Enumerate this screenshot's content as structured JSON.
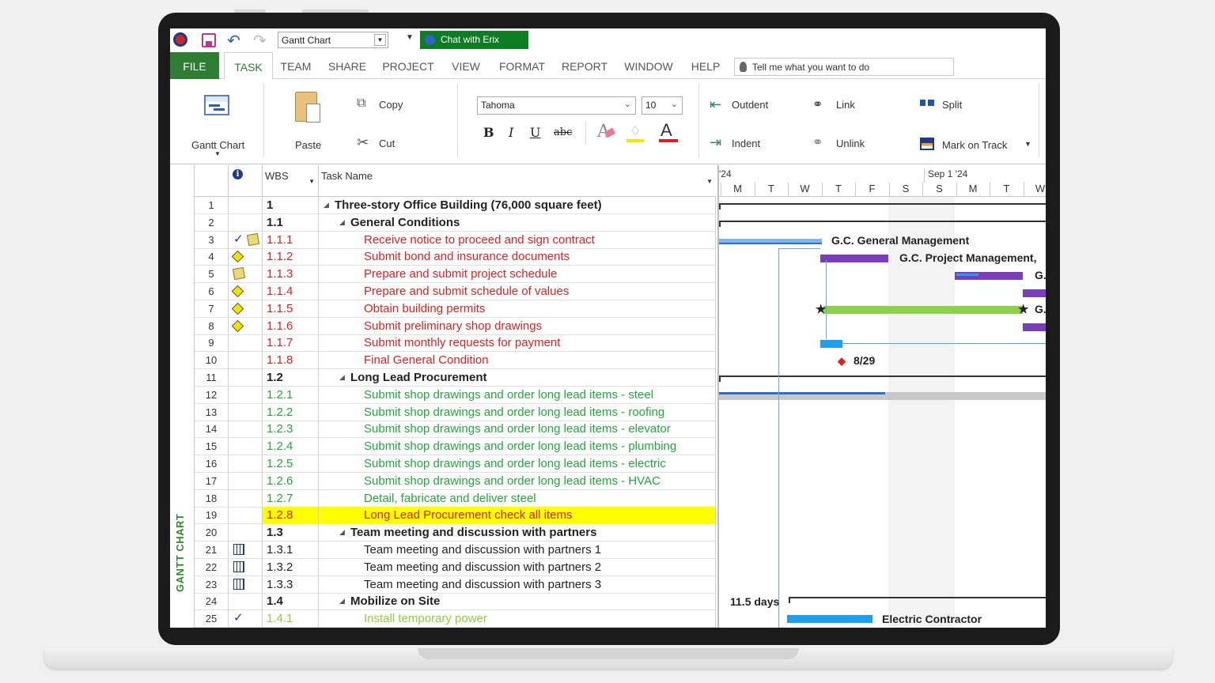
{
  "quick_access": {
    "view_selector": "Gantt Chart",
    "chat_label": "Chat with Erix"
  },
  "tabs": [
    "FILE",
    "TASK",
    "TEAM",
    "SHARE",
    "PROJECT",
    "VIEW",
    "FORMAT",
    "REPORT",
    "WINDOW",
    "HELP"
  ],
  "tell_me_placeholder": "Tell me what you want to do",
  "ribbon": {
    "gantt_chart": "Gantt Chart",
    "paste": "Paste",
    "copy": "Copy",
    "cut": "Cut",
    "font_name": "Tahoma",
    "font_size": "10",
    "bold": "B",
    "italic": "I",
    "underline": "U",
    "strike": "abc",
    "outdent": "Outdent",
    "indent": "Indent",
    "link": "Link",
    "unlink": "Unlink",
    "split": "Split",
    "mark_on_track": "Mark on Track"
  },
  "side_label": "GANTT CHART",
  "grid": {
    "col_wbs": "WBS",
    "col_task": "Task Name",
    "rows": [
      {
        "id": "1",
        "wbs": "1",
        "name": "Three-story Office Building (76,000 square feet)",
        "level": 0,
        "summary": true,
        "color": "#222222",
        "indicators": []
      },
      {
        "id": "2",
        "wbs": "1.1",
        "name": "General Conditions",
        "level": 1,
        "summary": true,
        "color": "#222222",
        "indicators": []
      },
      {
        "id": "3",
        "wbs": "1.1.1",
        "name": "Receive notice to proceed and sign contract",
        "level": 2,
        "summary": false,
        "color": "#e02020",
        "indicators": [
          "check",
          "note"
        ]
      },
      {
        "id": "4",
        "wbs": "1.1.2",
        "name": "Submit bond and insurance documents",
        "level": 2,
        "summary": false,
        "color": "#e02020",
        "indicators": [
          "warn"
        ]
      },
      {
        "id": "5",
        "wbs": "1.1.3",
        "name": "Prepare and submit project schedule",
        "level": 2,
        "summary": false,
        "color": "#e02020",
        "indicators": [
          "note"
        ]
      },
      {
        "id": "6",
        "wbs": "1.1.4",
        "name": "Prepare and submit schedule of values",
        "level": 2,
        "summary": false,
        "color": "#e02020",
        "indicators": [
          "warn"
        ]
      },
      {
        "id": "7",
        "wbs": "1.1.5",
        "name": "Obtain building permits",
        "level": 2,
        "summary": false,
        "color": "#e02020",
        "indicators": [
          "warn"
        ]
      },
      {
        "id": "8",
        "wbs": "1.1.6",
        "name": "Submit preliminary shop drawings",
        "level": 2,
        "summary": false,
        "color": "#e02020",
        "indicators": [
          "warn"
        ]
      },
      {
        "id": "9",
        "wbs": "1.1.7",
        "name": "Submit monthly requests for payment",
        "level": 2,
        "summary": false,
        "color": "#e02020",
        "indicators": []
      },
      {
        "id": "10",
        "wbs": "1.1.8",
        "name": "Final General Condition",
        "level": 2,
        "summary": false,
        "color": "#e02020",
        "indicators": []
      },
      {
        "id": "11",
        "wbs": "1.2",
        "name": "Long Lead Procurement",
        "level": 1,
        "summary": true,
        "color": "#222222",
        "indicators": []
      },
      {
        "id": "12",
        "wbs": "1.2.1",
        "name": "Submit shop drawings and order long lead items - steel",
        "level": 2,
        "summary": false,
        "color": "#22a83a",
        "indicators": []
      },
      {
        "id": "13",
        "wbs": "1.2.2",
        "name": "Submit shop drawings and order long lead items - roofing",
        "level": 2,
        "summary": false,
        "color": "#22a83a",
        "indicators": []
      },
      {
        "id": "14",
        "wbs": "1.2.3",
        "name": "Submit shop drawings and order long lead items - elevator",
        "level": 2,
        "summary": false,
        "color": "#22a83a",
        "indicators": []
      },
      {
        "id": "15",
        "wbs": "1.2.4",
        "name": "Submit shop drawings and order long lead items - plumbing",
        "level": 2,
        "summary": false,
        "color": "#22a83a",
        "indicators": []
      },
      {
        "id": "16",
        "wbs": "1.2.5",
        "name": "Submit shop drawings and order long lead items - electric",
        "level": 2,
        "summary": false,
        "color": "#22a83a",
        "indicators": []
      },
      {
        "id": "17",
        "wbs": "1.2.6",
        "name": "Submit shop drawings and order long lead items - HVAC",
        "level": 2,
        "summary": false,
        "color": "#22a83a",
        "indicators": []
      },
      {
        "id": "18",
        "wbs": "1.2.7",
        "name": "Detail, fabricate and deliver steel",
        "level": 2,
        "summary": false,
        "color": "#22a83a",
        "indicators": []
      },
      {
        "id": "19",
        "wbs": "1.2.8",
        "name": "Long Lead Procurement check all items",
        "level": 2,
        "summary": false,
        "color": "#e02020",
        "highlight": "#ffff00",
        "indicators": []
      },
      {
        "id": "20",
        "wbs": "1.3",
        "name": "Team meeting and discussion with partners",
        "level": 1,
        "summary": true,
        "color": "#222222",
        "indicators": []
      },
      {
        "id": "21",
        "wbs": "1.3.1",
        "name": "Team meeting and discussion with partners 1",
        "level": 2,
        "summary": false,
        "color": "#222222",
        "indicators": [
          "cal"
        ]
      },
      {
        "id": "22",
        "wbs": "1.3.2",
        "name": "Team meeting and discussion with partners 2",
        "level": 2,
        "summary": false,
        "color": "#222222",
        "indicators": [
          "cal"
        ]
      },
      {
        "id": "23",
        "wbs": "1.3.3",
        "name": "Team meeting and discussion with partners 3",
        "level": 2,
        "summary": false,
        "color": "#222222",
        "indicators": [
          "cal"
        ]
      },
      {
        "id": "24",
        "wbs": "1.4",
        "name": "Mobilize on Site",
        "level": 1,
        "summary": true,
        "color": "#222222",
        "indicators": []
      },
      {
        "id": "25",
        "wbs": "1.4.1",
        "name": "Install temporary power",
        "level": 2,
        "summary": false,
        "color": "#8fcf3c",
        "indicators": [
          "check"
        ]
      }
    ]
  },
  "timeline": {
    "week1_label": "'24",
    "week2_label": "Sep 1 '24",
    "days": [
      "M",
      "T",
      "W",
      "T",
      "F",
      "S",
      "S",
      "M",
      "T",
      "W"
    ],
    "labels": {
      "gc_general": "G.C. General Management",
      "gc_project": "G.C. Project Management,",
      "g_short_1": "G.",
      "g_short_2": "G.",
      "milestone_date": "8/29",
      "duration": "11.5 days",
      "electric": "Electric Contractor"
    }
  },
  "colors": {
    "file_tab": "#2e7d32",
    "chat_button": "#0d7d23",
    "bar_blue": "#1f9ef0",
    "bar_purple": "#7a3fb8",
    "bar_green": "#8bd24a",
    "bar_gray": "#c8c8c8"
  }
}
